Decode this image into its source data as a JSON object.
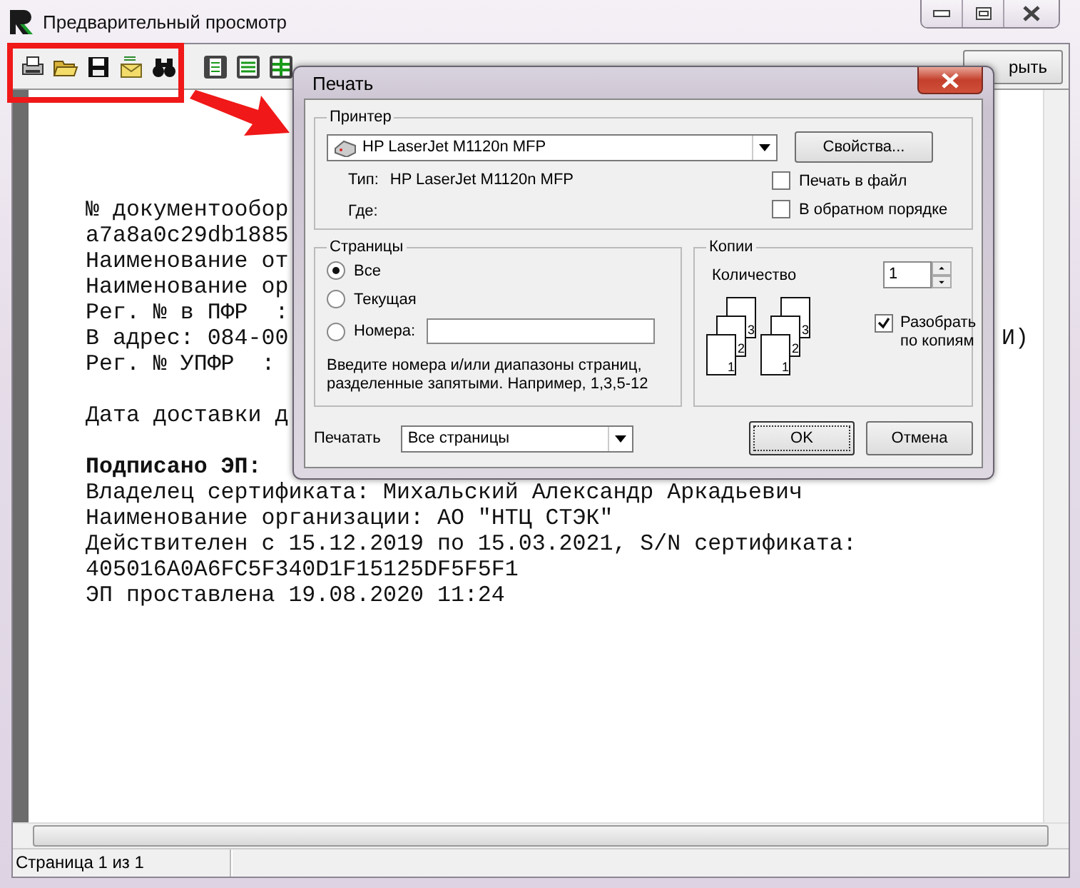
{
  "window": {
    "title": "Предварительный просмотр",
    "toolbar_button": "рыть"
  },
  "document": {
    "blocks": [
      {
        "lines": [
          {
            "text": "№ документообор",
            "bold": false
          },
          {
            "text": "a7a8a0c29db1885",
            "bold": false
          },
          {
            "text": "Наименование от",
            "bold": false
          },
          {
            "text": "Наименование ор",
            "bold": false
          },
          {
            "text": "Рег. № в ПФР  :",
            "bold": false
          },
          {
            "text": "В адрес: 084-00",
            "bold": false,
            "tail": "И)"
          },
          {
            "text": "Рег. № УПФР  :",
            "bold": false
          }
        ]
      },
      {
        "lines": [
          {
            "text": "Дата доставки д",
            "bold": false
          }
        ]
      },
      {
        "lines": [
          {
            "text": "Подписано ЭП:",
            "bold": true
          },
          {
            "text": "Владелец сертификата: Михальский Александр Аркадьевич",
            "bold": false
          },
          {
            "text": "Наименование организации: АО \"НТЦ СТЭК\"",
            "bold": false
          },
          {
            "text": "Действителен с 15.12.2019 по 15.03.2021, S/N сертификата:",
            "bold": false
          },
          {
            "text": "405016A0A6FC5F340D1F15125DF5F5F1",
            "bold": false
          },
          {
            "text": "ЭП проставлена 19.08.2020 11:24",
            "bold": false
          }
        ]
      }
    ]
  },
  "status_bar": {
    "page": "Страница 1 из 1"
  },
  "print_dialog": {
    "title": "Печать",
    "printer": {
      "legend": "Принтер",
      "name": "HP LaserJet M1120n MFP",
      "properties_button": "Свойства...",
      "type_label": "Тип:",
      "type_value": "HP LaserJet M1120n MFP",
      "where_label": "Где:",
      "options": [
        {
          "label": "Печать в файл",
          "checked": false
        },
        {
          "label": "В обратном порядке",
          "checked": false
        }
      ]
    },
    "pages": {
      "legend": "Страницы",
      "choices": [
        {
          "label": "Все",
          "selected": true
        },
        {
          "label": "Текущая",
          "selected": false
        },
        {
          "label": "Номера:",
          "selected": false
        }
      ],
      "hint": "Введите номера и/или диапазоны страниц, разделенные запятыми. Например, 1,3,5-12"
    },
    "copies": {
      "legend": "Копии",
      "count_label": "Количество",
      "count": "1",
      "stacks": [
        [
          "3",
          "2",
          "1"
        ],
        [
          "3",
          "2",
          "1"
        ]
      ],
      "collate": {
        "label": "Разобрать по копиям",
        "checked": true
      }
    },
    "print_range": {
      "label": "Печатать",
      "value": "Все страницы"
    },
    "buttons": [
      "OK",
      "Отмена"
    ]
  }
}
